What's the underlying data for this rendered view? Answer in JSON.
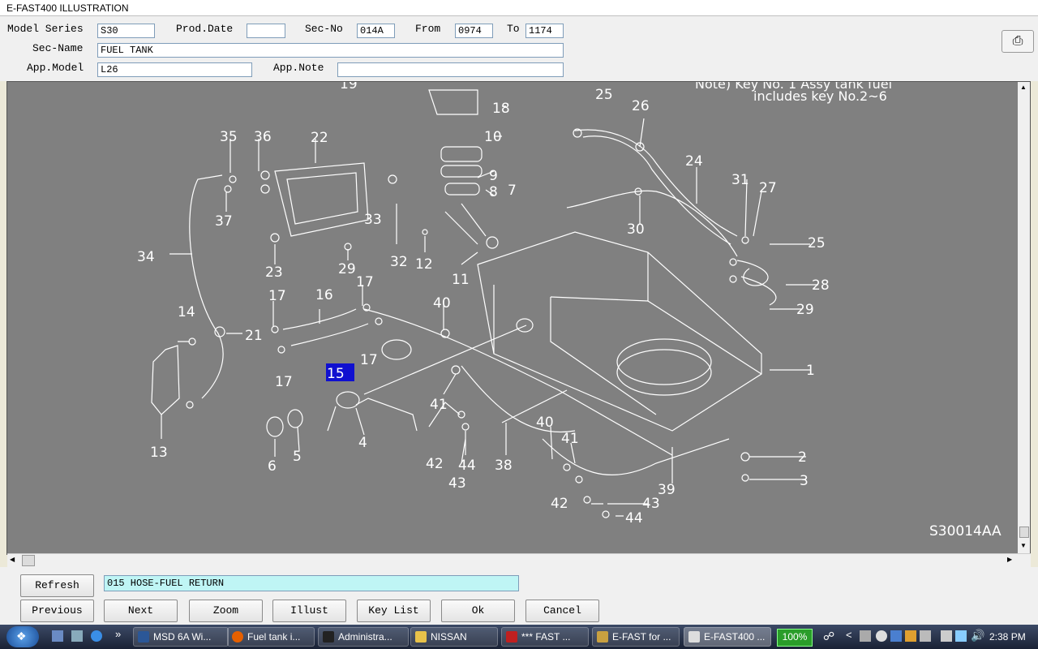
{
  "window": {
    "title": "E-FAST400 ILLUSTRATION"
  },
  "form": {
    "model_series_label": "Model Series",
    "model_series": "S30",
    "prod_date_label": "Prod.Date",
    "prod_date": "",
    "sec_no_label": "Sec-No",
    "sec_no": "014A",
    "from_label": "From",
    "from": "0974",
    "to_label": "To",
    "to": "1174",
    "sec_name_label": "Sec-Name",
    "sec_name": "FUEL TANK",
    "app_model_label": "App.Model",
    "app_model": "L26",
    "app_note_label": "App.Note",
    "app_note": ""
  },
  "illustration": {
    "note_line1": "Note) Key No. 1 Assy tank fuel",
    "note_line2": "includes key No.2~6",
    "code": "S30014AA",
    "selected_key": "15",
    "keys": [
      "1",
      "2",
      "3",
      "4",
      "5",
      "6",
      "7",
      "8",
      "9",
      "10",
      "11",
      "12",
      "13",
      "14",
      "16",
      "17",
      "18",
      "19",
      "21",
      "22",
      "23",
      "24",
      "25",
      "26",
      "27",
      "28",
      "29",
      "30",
      "31",
      "32",
      "33",
      "34",
      "35",
      "36",
      "37",
      "38",
      "39",
      "40",
      "41",
      "42",
      "43",
      "44"
    ]
  },
  "bottom": {
    "refresh": "Refresh",
    "status": "015 HOSE-FUEL RETURN",
    "previous": "Previous",
    "next": "Next",
    "zoom": "Zoom",
    "illust": "Illust",
    "key_list": "Key List",
    "ok": "Ok",
    "cancel": "Cancel"
  },
  "taskbar": {
    "items": [
      "MSD 6A Wi...",
      "Fuel tank i...",
      "Administra...",
      "NISSAN",
      "*** FAST ...",
      "E-FAST for ...",
      "E-FAST400 ..."
    ],
    "zoom": "100%",
    "clock": "2:38 PM"
  }
}
